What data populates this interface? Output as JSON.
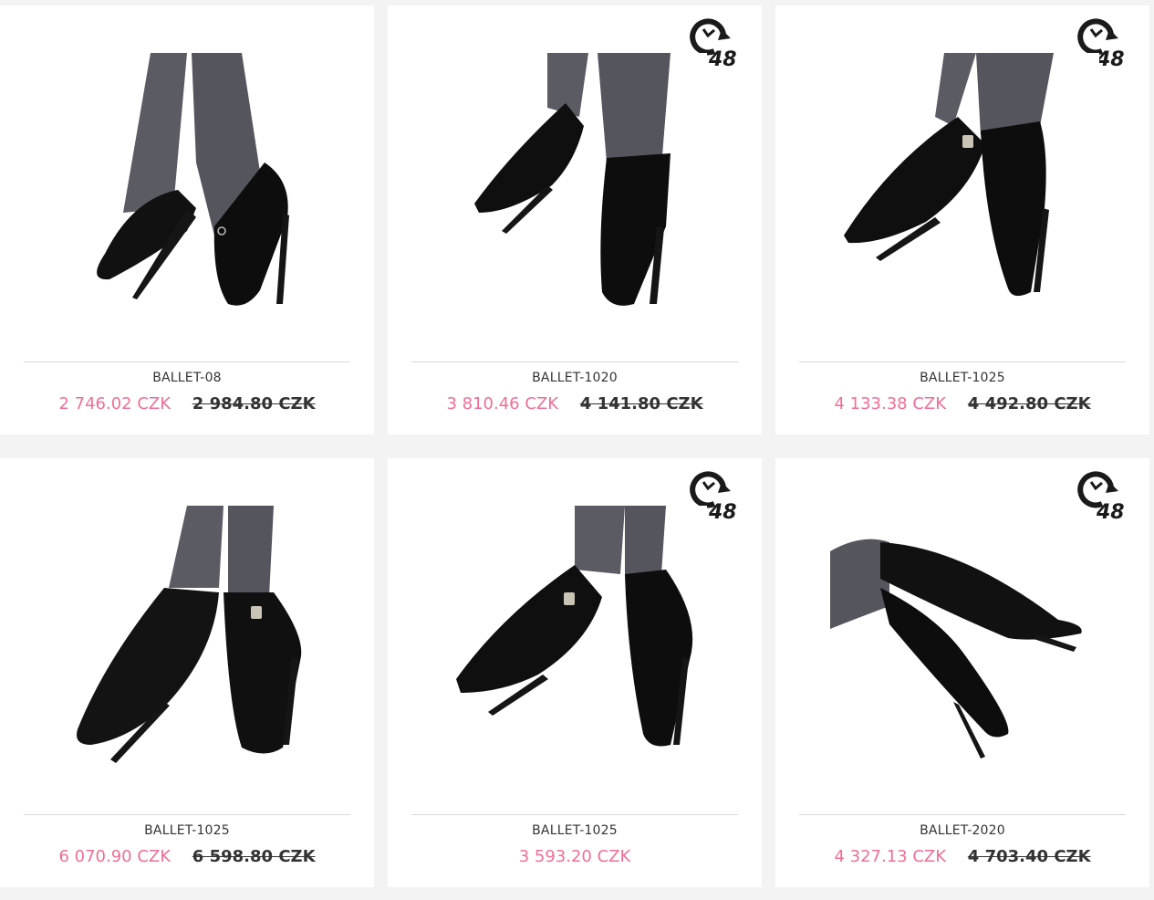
{
  "products": [
    {
      "name": "BALLET-08",
      "price": "2 746.02 CZK",
      "old_price": "2 984.80 CZK",
      "badge": false,
      "image": "ballet-heels-image"
    },
    {
      "name": "BALLET-1020",
      "price": "3 810.46 CZK",
      "old_price": "4 141.80 CZK",
      "badge": true,
      "image": "ballet-boots-image"
    },
    {
      "name": "BALLET-1025",
      "price": "4 133.38 CZK",
      "old_price": "4 492.80 CZK",
      "badge": true,
      "image": "ballet-boots-image"
    },
    {
      "name": "BALLET-1025",
      "price": "6 070.90 CZK",
      "old_price": "6 598.80 CZK",
      "badge": false,
      "image": "ballet-boots-image"
    },
    {
      "name": "BALLET-1025",
      "price": "3 593.20 CZK",
      "old_price": "",
      "badge": true,
      "image": "ballet-boots-image"
    },
    {
      "name": "BALLET-2020",
      "price": "4 327.13 CZK",
      "old_price": "4 703.40 CZK",
      "badge": true,
      "image": "ballet-knee-boots-image"
    }
  ],
  "badge_text": "48",
  "colors": {
    "sale_price": "#f06e96",
    "old_price": "#333333",
    "background": "#f3f3f3",
    "card": "#ffffff"
  }
}
